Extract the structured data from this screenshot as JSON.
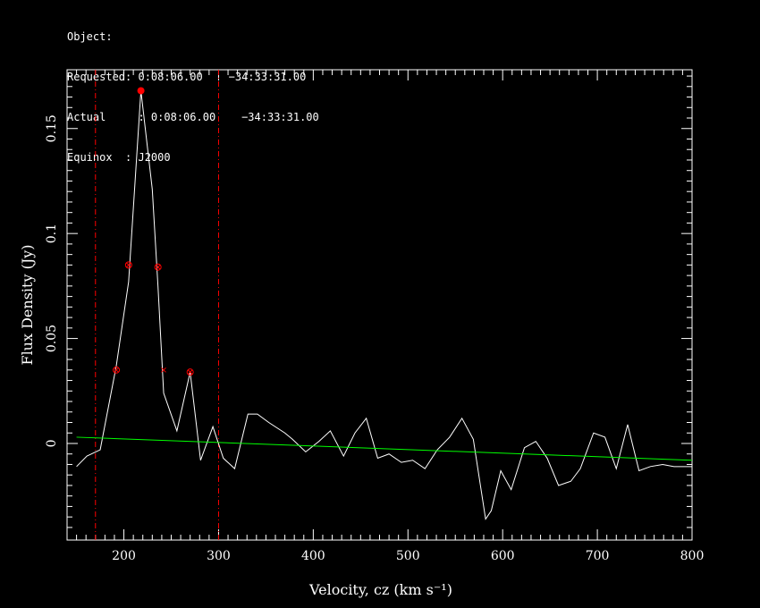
{
  "header": {
    "object_label": "Object:",
    "requested": "Requested: 0:08:06.00    −34:33:31.00",
    "actual": "Actual     : 0:08:06.00    −34:33:31.00",
    "equinox": "Equinox  : J2000"
  },
  "colors": {
    "spectrum": "#ffffff",
    "baseline": "#00ff00",
    "markers": "#ff0000",
    "background": "#000000"
  },
  "chart_data": {
    "type": "line",
    "xlabel": "Velocity, cz (km s⁻¹)",
    "ylabel": "Flux Density (Jy)",
    "xlim": [
      140,
      800
    ],
    "ylim": [
      -0.046,
      0.178
    ],
    "xticks": [
      200,
      300,
      400,
      500,
      600,
      700,
      800
    ],
    "yticks": [
      0,
      0.05,
      0.1,
      0.15
    ],
    "xtick_labels": [
      "200",
      "300",
      "400",
      "500",
      "600",
      "700",
      "800"
    ],
    "ytick_labels": [
      "0",
      "0.05",
      "0.1",
      "0.15"
    ],
    "series": [
      {
        "role": "spectrum",
        "x": [
          150,
          161,
          175,
          192,
          205,
          218,
          230,
          236,
          242,
          256,
          270,
          281,
          294,
          305,
          317,
          331,
          341,
          353,
          370,
          378,
          392,
          406,
          418,
          432,
          444,
          456,
          468,
          480,
          493,
          505,
          518,
          531,
          544,
          557,
          569,
          582,
          588,
          598,
          609,
          623,
          635,
          647,
          659,
          672,
          682,
          696,
          708,
          720,
          732,
          744,
          756,
          769,
          781,
          800
        ],
        "y": [
          -0.011,
          -0.006,
          -0.003,
          0.037,
          0.077,
          0.168,
          0.121,
          0.075,
          0.024,
          0.006,
          0.034,
          -0.008,
          0.008,
          -0.007,
          -0.012,
          0.014,
          0.014,
          0.01,
          0.005,
          0.002,
          -0.004,
          0.001,
          0.006,
          -0.006,
          0.005,
          0.012,
          -0.007,
          -0.005,
          -0.009,
          -0.008,
          -0.012,
          -0.003,
          0.003,
          0.012,
          0.002,
          -0.036,
          -0.032,
          -0.013,
          -0.022,
          -0.002,
          0.001,
          -0.007,
          -0.02,
          -0.018,
          -0.012,
          0.005,
          0.003,
          -0.012,
          0.009,
          -0.013,
          -0.011,
          -0.01,
          -0.011,
          -0.011
        ]
      },
      {
        "role": "baseline",
        "x": [
          150,
          800
        ],
        "y": [
          0.003,
          -0.008
        ]
      }
    ],
    "markers": [
      {
        "symbol": "filled-dot",
        "x": 218,
        "y": 0.168
      },
      {
        "symbol": "circle-x",
        "x": 205,
        "y": 0.085
      },
      {
        "symbol": "circle-x",
        "x": 236,
        "y": 0.084
      },
      {
        "symbol": "circle-x",
        "x": 192,
        "y": 0.035
      },
      {
        "symbol": "circle-x",
        "x": 270,
        "y": 0.034
      },
      {
        "symbol": "x",
        "x": 242,
        "y": 0.035
      }
    ],
    "vlines": [
      170,
      300
    ],
    "grid": false
  }
}
